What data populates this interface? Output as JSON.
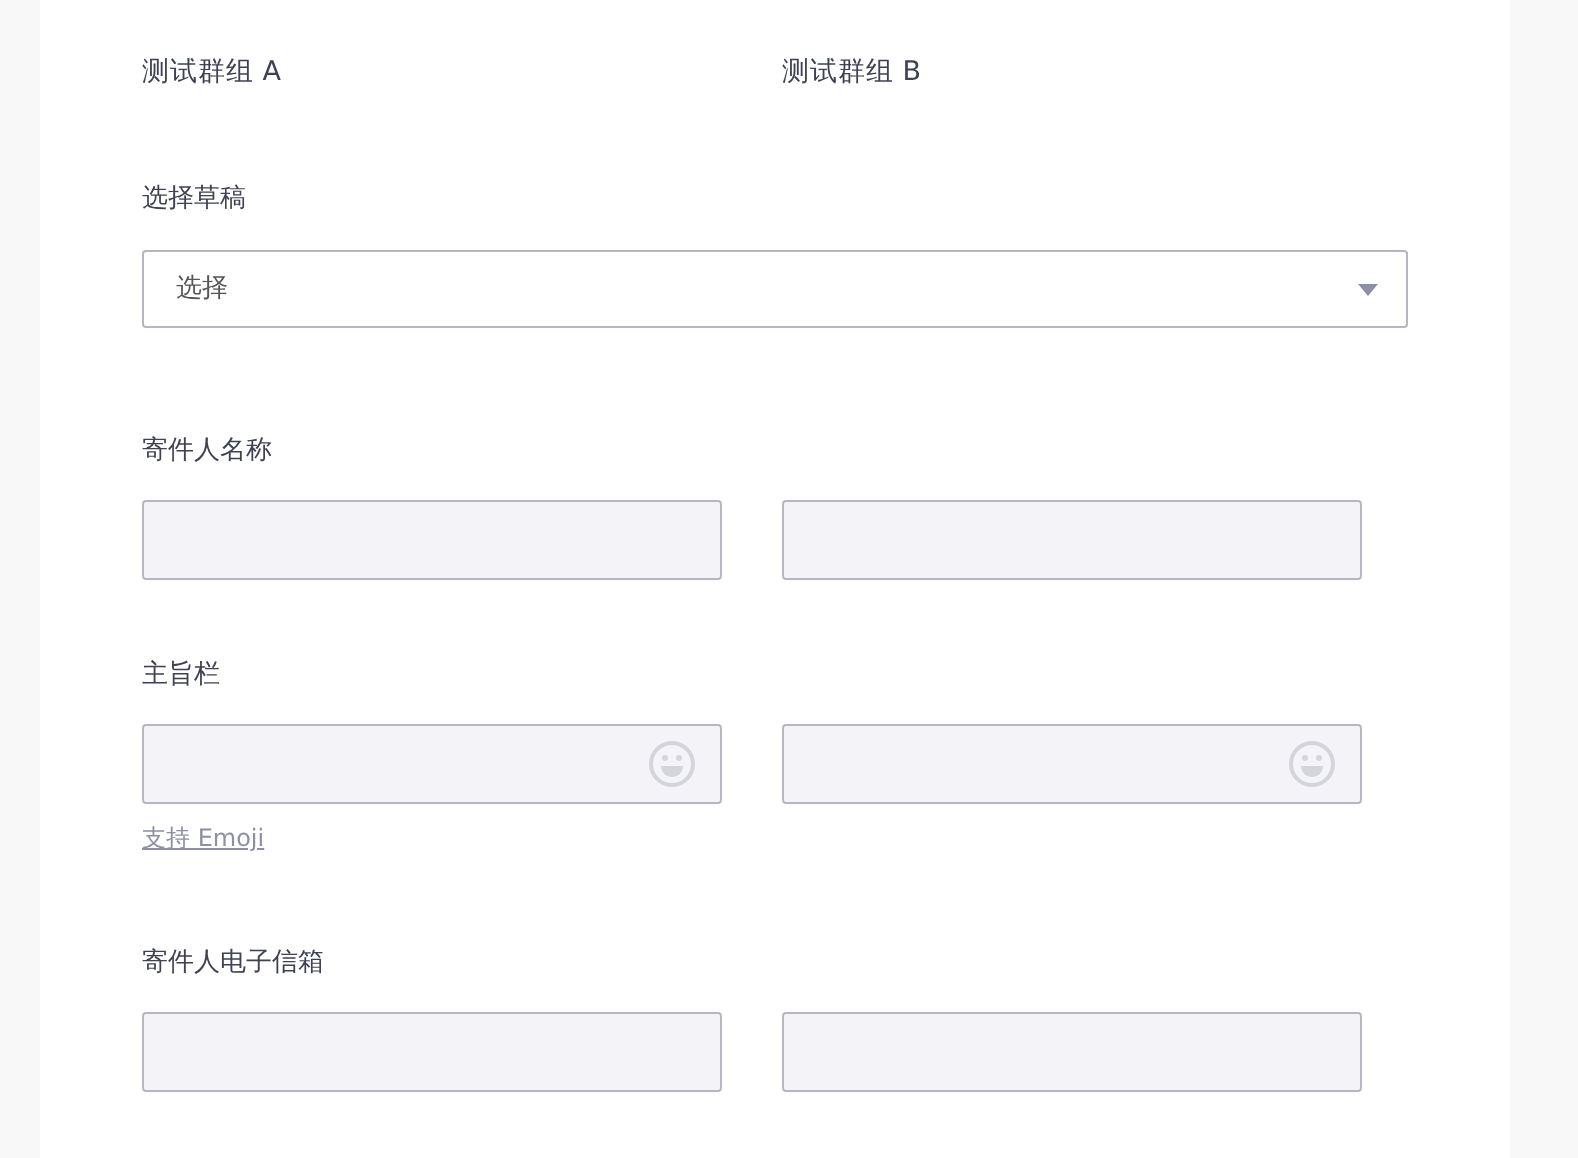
{
  "groups": [
    "测试群组 A",
    "测试群组 B"
  ],
  "draft": {
    "label": "选择草稿",
    "placeholder": "选择"
  },
  "fields": [
    {
      "label": "寄件人名称",
      "kind": "plain"
    },
    {
      "label": "主旨栏",
      "kind": "emoji",
      "note": "支持 Emoji"
    },
    {
      "label": "寄件人电子信箱",
      "kind": "plain"
    }
  ]
}
